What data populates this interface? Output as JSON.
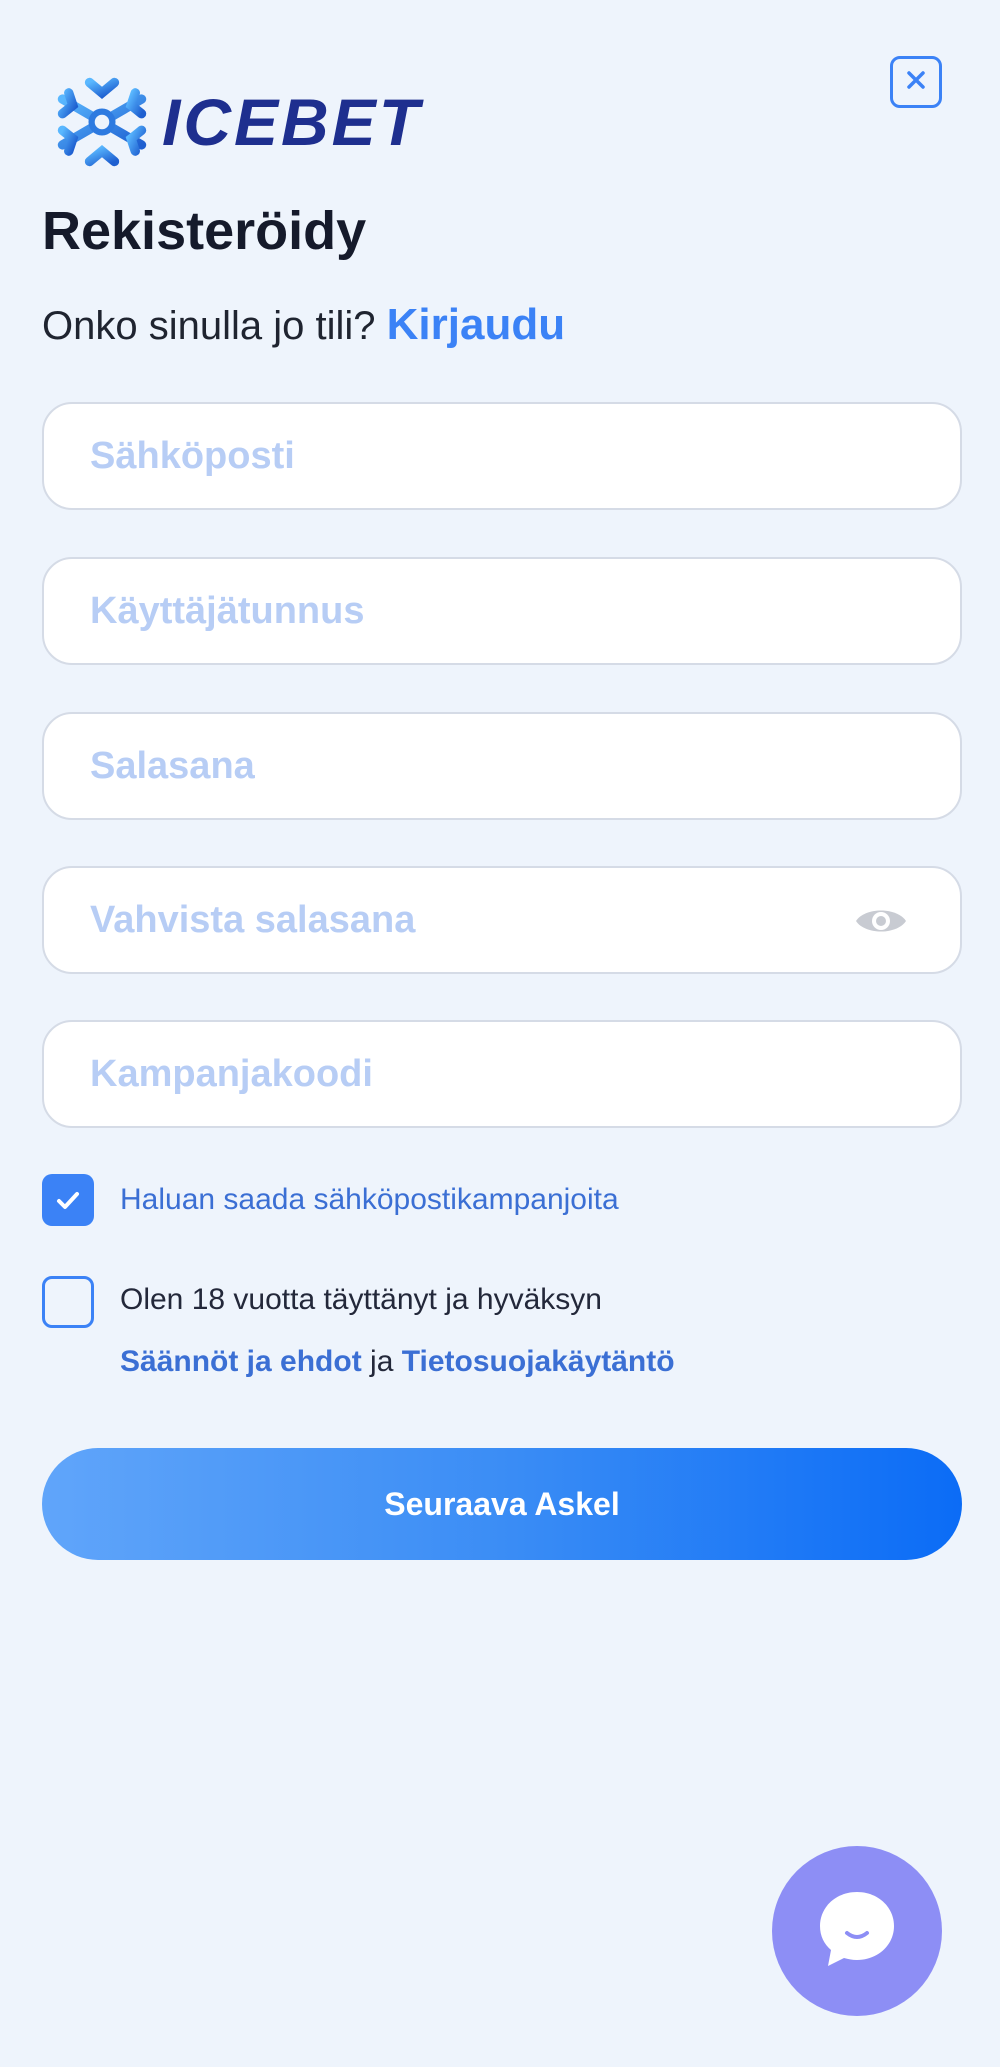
{
  "brand": {
    "name": "ICEBET",
    "logo_color": "#1e2f8f",
    "logo_icon": "snowflake-icon"
  },
  "header": {
    "close_icon": "close-icon"
  },
  "title": "Rekisteröidy",
  "login_prompt": {
    "text": "Onko sinulla jo tili?",
    "link": "Kirjaudu"
  },
  "form": {
    "email_placeholder": "Sähköposti",
    "username_placeholder": "Käyttäjätunnus",
    "password_placeholder": "Salasana",
    "confirm_password_placeholder": "Vahvista salasana",
    "promo_code_placeholder": "Kampanjakoodi",
    "show_password_icon": "eye-icon"
  },
  "checkboxes": {
    "marketing": {
      "label": "Haluan saada sähköpostikampanjoita",
      "checked": true
    },
    "age_terms": {
      "label": "Olen 18 vuotta täyttänyt ja hyväksyn",
      "checked": false,
      "terms_link": "Säännöt ja ehdot",
      "conjunction": "ja",
      "privacy_link": "Tietosuojakäytäntö"
    }
  },
  "submit_label": "Seuraava Askel",
  "chat_icon": "chat-bubble-icon",
  "colors": {
    "accent": "#3b82f6",
    "background": "#eef4fc",
    "placeholder": "#b7cdf5",
    "chat_button": "#8d8ef5"
  }
}
